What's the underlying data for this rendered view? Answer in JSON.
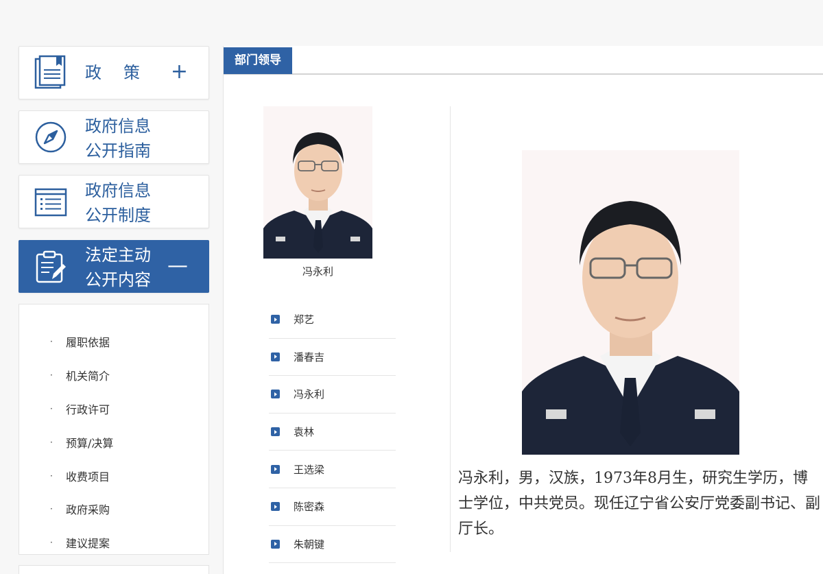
{
  "sidebar": {
    "policy": {
      "label": "政策",
      "sign": "+"
    },
    "guide": {
      "line1": "政府信息",
      "line2": "公开指南"
    },
    "system": {
      "line1": "政府信息",
      "line2": "公开制度"
    },
    "legal": {
      "line1": "法定主动",
      "line2": "公开内容",
      "sign": "—"
    },
    "sub_items": [
      "履职依据",
      "机关简介",
      "行政许可",
      "预算/决算",
      "收费项目",
      "政府采购",
      "建议提案"
    ],
    "bullet": "·"
  },
  "main": {
    "tab_label": "部门领导",
    "featured_name": "冯永利",
    "leaders": [
      "郑艺",
      "潘春吉",
      "冯永利",
      "袁林",
      "王选梁",
      "陈密森",
      "朱朝键"
    ],
    "bio": "冯永利，男，汉族，1973年8月生，研究生学历，博士学位，中共党员。现任辽宁省公安厅党委副书记、副厅长。"
  },
  "colors": {
    "accent": "#2f62a5",
    "accent_text": "#2c5f9e"
  }
}
